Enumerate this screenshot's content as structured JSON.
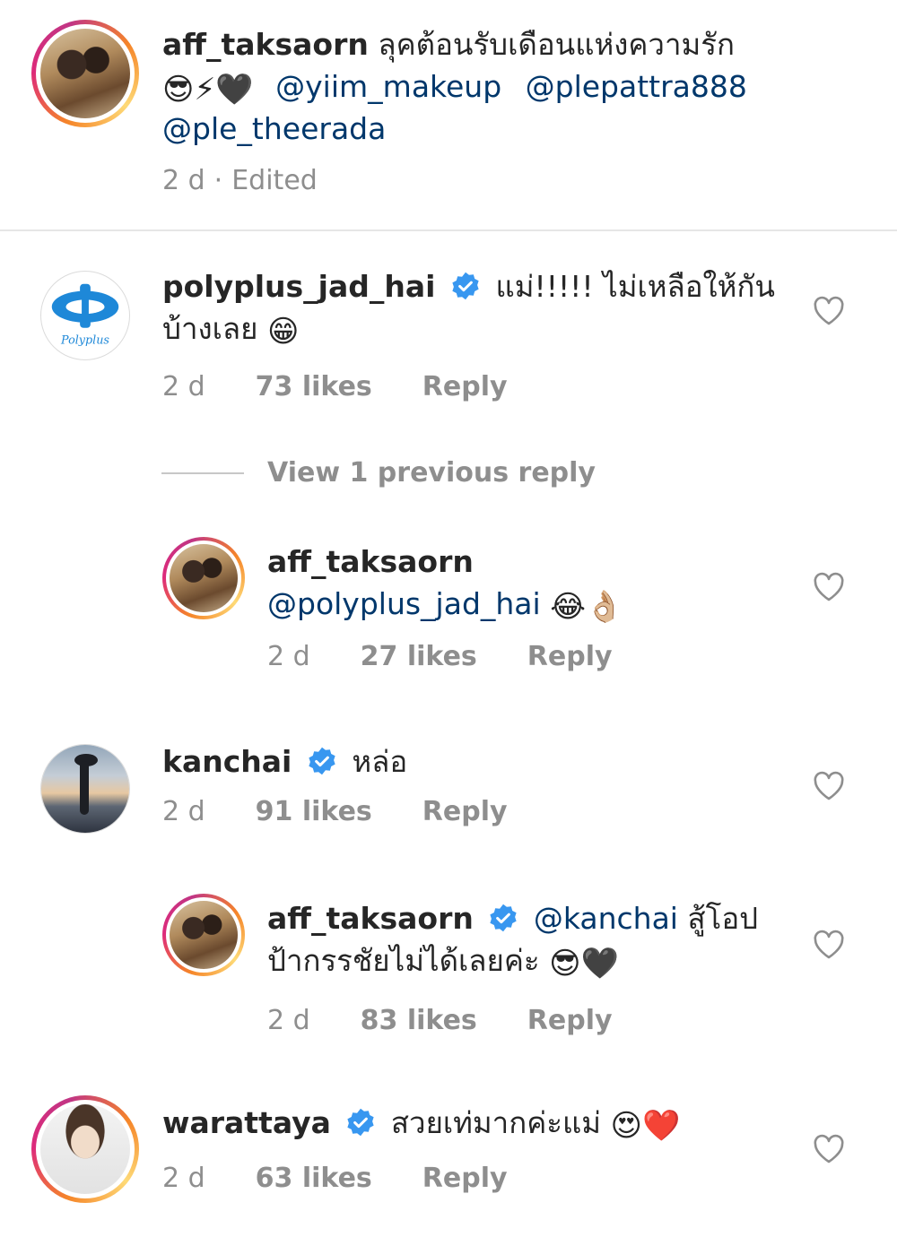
{
  "caption": {
    "username": "aff_taksaorn",
    "text": "ลุคต้อนรับเดือนแห่งความรัก",
    "emojis": "😎⚡🖤",
    "mentions": [
      "@yiim_makeup",
      "@plepattra888",
      "@ple_theerada"
    ],
    "time": "2 d",
    "separator": "·",
    "edited": "Edited"
  },
  "comments": [
    {
      "username": "polyplus_jad_hai",
      "avatar_text": "Polyplus",
      "text": "แม่!!!!! ไม่เหลือให้กัน",
      "text2": "บ้างเลย",
      "emoji": "😁",
      "time": "2 d",
      "likes": "73 likes",
      "reply": "Reply",
      "view_replies": "View 1 previous reply"
    },
    {
      "username": "aff_taksaorn",
      "mention": "@polyplus_jad_hai",
      "emoji": "😂👌🏼",
      "time": "2 d",
      "likes": "27 likes",
      "reply": "Reply"
    },
    {
      "username": "kanchai",
      "text": "หล่อ",
      "time": "2 d",
      "likes": "91 likes",
      "reply": "Reply"
    },
    {
      "username": "aff_taksaorn",
      "mention": "@kanchai",
      "text": "สู้โอป",
      "text2": "ป้ากรรชัยไม่ได้เลยค่ะ",
      "emoji": "😎🖤",
      "time": "2 d",
      "likes": "83 likes",
      "reply": "Reply"
    },
    {
      "username": "warattaya",
      "text": "สวยเท่มากค่ะแม่",
      "emoji": "😍❤️",
      "time": "2 d",
      "likes": "63 likes",
      "reply": "Reply"
    }
  ],
  "colors": {
    "verified": "#3897f0",
    "mention": "#00376b",
    "meta": "#8e8e8e"
  },
  "icons": {
    "like": "heart-outline-icon",
    "verified": "verified-badge-icon"
  }
}
